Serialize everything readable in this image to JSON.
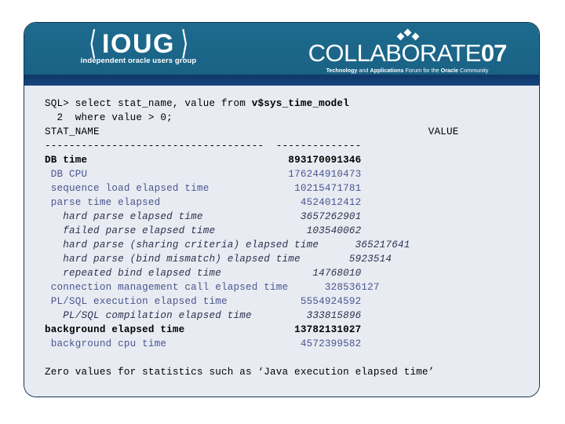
{
  "header": {
    "ioug": {
      "bracket_left": "⟨",
      "bracket_right": "⟩",
      "wordmark": "IOUG",
      "tagline": "independent oracle users group"
    },
    "collaborate": {
      "word": "COLLABORATE",
      "year": "07",
      "tagline_1": "Technology",
      "tagline_2": " and ",
      "tagline_3": "Applications",
      "tagline_4": " Forum for the ",
      "tagline_5": "Oracle",
      "tagline_6": " Community"
    }
  },
  "terminal": {
    "query_line_1_prompt": "SQL> select stat_name, value from ",
    "query_line_1_object": "v$sys_time_model",
    "query_line_2": "  2  where value > 0;",
    "col_header": "STAT_NAME                                                      VALUE",
    "col_separator": "------------------------------------  --------------",
    "rows": [
      {
        "name": "DB time",
        "indent": 0,
        "value": "893170091346",
        "style": "row-bold"
      },
      {
        "name": "DB CPU",
        "indent": 1,
        "value": "176244910473",
        "style": "row-light"
      },
      {
        "name": "sequence load elapsed time",
        "indent": 1,
        "value": "10215471781",
        "style": "row-light"
      },
      {
        "name": "parse time elapsed",
        "indent": 1,
        "value": "4524012412",
        "style": "row-light"
      },
      {
        "name": "hard parse elapsed time",
        "indent": 3,
        "value": "3657262901",
        "style": "row-ital"
      },
      {
        "name": "failed parse elapsed time",
        "indent": 3,
        "value": "103540062",
        "style": "row-ital"
      },
      {
        "name": "hard parse (sharing criteria) elapsed time",
        "indent": 3,
        "value": "365217641",
        "style": "row-ital"
      },
      {
        "name": "hard parse (bind mismatch) elapsed time",
        "indent": 3,
        "value": "5923514",
        "style": "row-ital"
      },
      {
        "name": "repeated bind elapsed time",
        "indent": 3,
        "value": "14768010",
        "style": "row-ital"
      },
      {
        "name": "connection management call elapsed time",
        "indent": 1,
        "value": "328536127",
        "style": "row-light"
      },
      {
        "name": "PL/SQL execution elapsed time",
        "indent": 1,
        "value": "5554924592",
        "style": "row-light"
      },
      {
        "name": "PL/SQL compilation elapsed time",
        "indent": 3,
        "value": "333815896",
        "style": "row-ital"
      },
      {
        "name": "background elapsed time",
        "indent": 0,
        "value": "13782131027",
        "style": "row-bold"
      },
      {
        "name": "background cpu time",
        "indent": 1,
        "value": "4572399582",
        "style": "row-light"
      }
    ],
    "footer_note": "Zero values for statistics such as ‘Java execution elapsed time’"
  },
  "colors": {
    "header_teal": "#1b6688",
    "header_band_navy": "#123e72",
    "card_bg": "#e8ecf2",
    "card_border": "#13324e",
    "text_light_blue": "#4a5490",
    "text_italic_slate": "#2c3050"
  }
}
